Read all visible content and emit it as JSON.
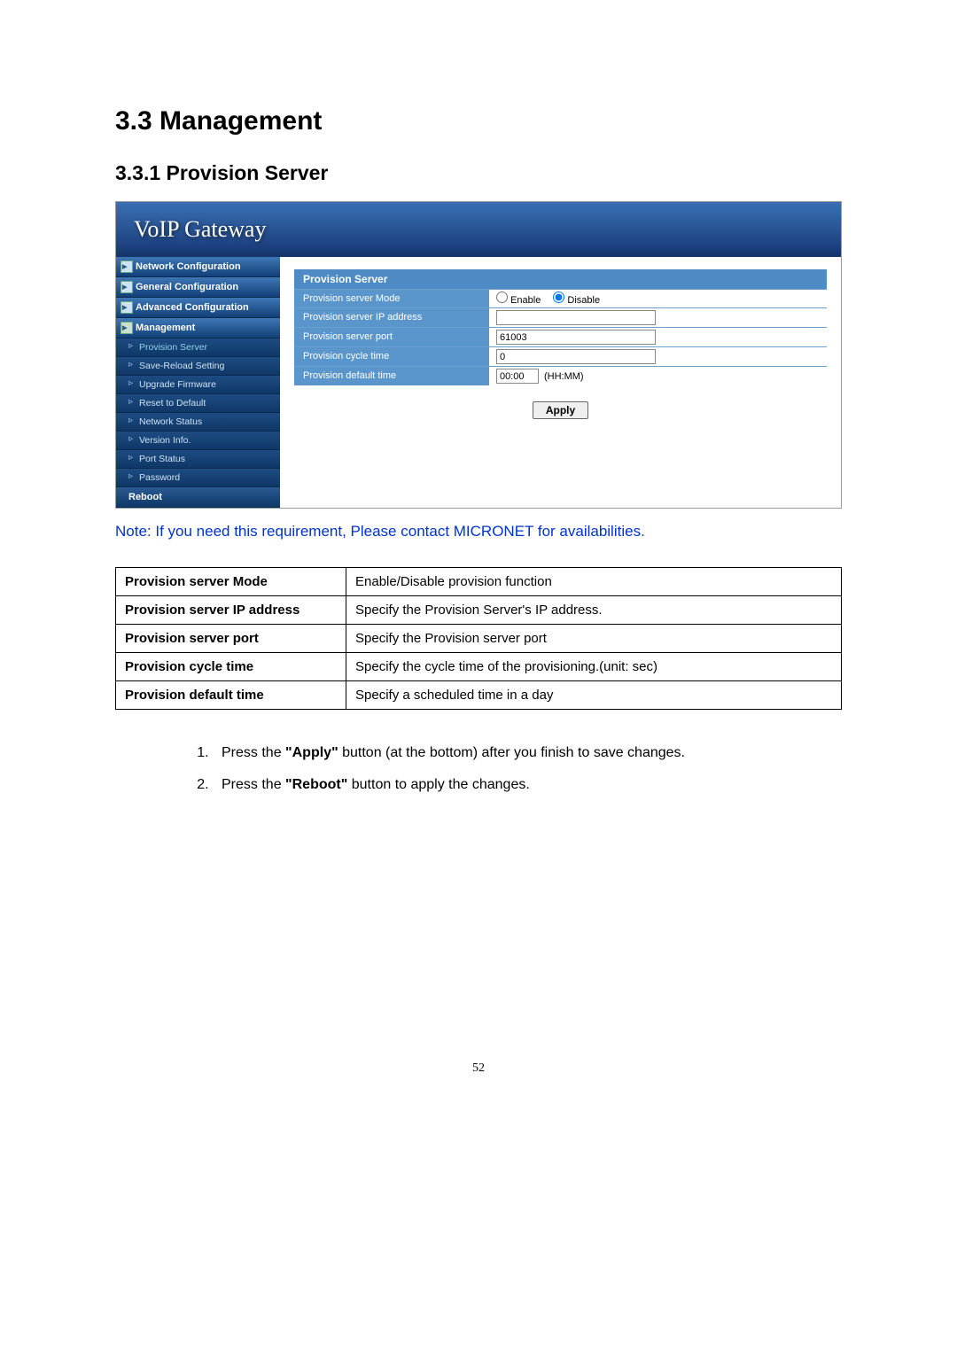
{
  "headings": {
    "h1": "3.3 Management",
    "h2": "3.3.1  Provision Server"
  },
  "screenshot": {
    "app_title": "VoIP  Gateway",
    "sidebar": {
      "top": [
        "Network Configuration",
        "General Configuration",
        "Advanced Configuration",
        "Management"
      ],
      "sub": [
        "Provision Server",
        "Save-Reload Setting",
        "Upgrade Firmware",
        "Reset to Default",
        "Network Status",
        "Version Info.",
        "Port Status",
        "Password"
      ],
      "reboot": "Reboot"
    },
    "panel": {
      "title": "Provision Server",
      "rows": [
        {
          "label": "Provision server Mode",
          "type": "radio",
          "enable": "Enable",
          "disable": "Disable",
          "selected": "disable"
        },
        {
          "label": "Provision server IP address",
          "type": "text",
          "value": ""
        },
        {
          "label": "Provision server port",
          "type": "text",
          "value": "61003"
        },
        {
          "label": "Provision cycle time",
          "type": "text",
          "value": "0"
        },
        {
          "label": "Provision default time",
          "type": "time",
          "value": "00:00",
          "suffix": "(HH:MM)"
        }
      ],
      "apply": "Apply"
    }
  },
  "note": "Note: If you need this requirement, Please contact MICRONET for availabilities.",
  "desc_table": [
    [
      "Provision server Mode",
      "Enable/Disable provision function"
    ],
    [
      "Provision server IP address",
      "Specify the Provision Server's IP address."
    ],
    [
      "Provision server port",
      "Specify the Provision server port"
    ],
    [
      "Provision cycle time",
      "Specify the cycle time of the provisioning.(unit: sec)"
    ],
    [
      "Provision default time",
      "Specify a scheduled time in a day"
    ]
  ],
  "steps": {
    "s1a": "Press the ",
    "s1b": "\"Apply\"",
    "s1c": " button (at the bottom) after you finish to save changes.",
    "s2a": "Press the ",
    "s2b": "\"Reboot\"",
    "s2c": " button to apply the changes."
  },
  "page_number": "52"
}
